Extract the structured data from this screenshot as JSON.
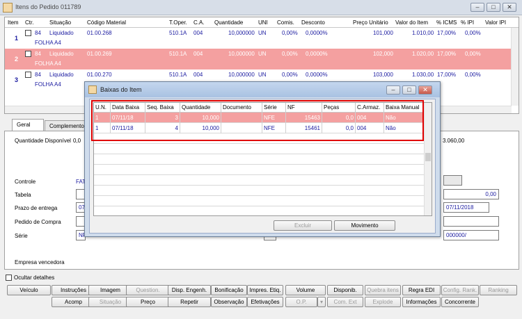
{
  "window": {
    "title": "Itens do Pedido 011789"
  },
  "grid": {
    "headers": [
      "Item",
      "Ctr.",
      "Situação",
      "Código Material",
      "T.Oper.",
      "C.A.",
      "Quantidade",
      "UNI",
      "Comis.",
      "Desconto",
      "Preço Unitário",
      "Valor do Item",
      "% ICMS",
      "% IPI",
      "Valor IPI"
    ],
    "rows": [
      {
        "item": "1",
        "ctr": "84",
        "situacao": "Liquidado",
        "sub": "FOLHA A4",
        "codigo": "01.00.268",
        "toper": "510.1A",
        "ca": "004",
        "quantidade": "10,000000",
        "uni": "UN",
        "comis": "0,00%",
        "desconto": "0,0000%",
        "preco": "101,000",
        "valor": "1.010,00",
        "icms": "17,00%",
        "ipi": "0,00%"
      },
      {
        "item": "2",
        "ctr": "84",
        "situacao": "Liquidado",
        "sub": "FOLHA A4",
        "codigo": "01.00.269",
        "toper": "510.1A",
        "ca": "004",
        "quantidade": "10,000000",
        "uni": "UN",
        "comis": "0,00%",
        "desconto": "0,0000%",
        "preco": "102,000",
        "valor": "1.020,00",
        "icms": "17,00%",
        "ipi": "0,00%"
      },
      {
        "item": "3",
        "ctr": "84",
        "situacao": "Liquidado",
        "sub": "FOLHA A4",
        "codigo": "01.00.270",
        "toper": "510.1A",
        "ca": "004",
        "quantidade": "10,000000",
        "uni": "UN",
        "comis": "0,00%",
        "desconto": "0,0000%",
        "preco": "103,000",
        "valor": "1.030,00",
        "icms": "17,00%",
        "ipi": "0,00%"
      }
    ]
  },
  "tabs": [
    "Geral",
    "Complemento"
  ],
  "form": {
    "qtd_disponivel_label": "Quantidade Disponível",
    "qtd_disponivel_value": "0,0",
    "right_value": "3.060,00",
    "controle_label": "Controle",
    "controle_value": "FAT",
    "tabela_label": "Tabela",
    "tabela_right_value": "0,00",
    "prazo_label": "Prazo de entrega",
    "prazo_value": "07/",
    "prazo_right_value": "07/11/2018",
    "pedido_compra_label": "Pedido de Compra",
    "serie_label": "Série",
    "serie_value": "NF",
    "serie_right_value": "000000/",
    "empresa_label": "Empresa vencedora",
    "ocultar_label": "Ocultar detalhes"
  },
  "buttons_row1": [
    {
      "label": "Veículo",
      "enabled": true
    },
    {
      "label": "Instruções",
      "enabled": true
    },
    {
      "label": "Imagem",
      "enabled": true
    },
    {
      "label": "Question.",
      "enabled": false
    },
    {
      "label": "Disp. Engenh.",
      "enabled": true
    },
    {
      "label": "Bonificação",
      "enabled": true
    },
    {
      "label": "Impres. Etiq.",
      "enabled": true
    },
    {
      "label": "Volume",
      "enabled": true
    },
    {
      "label": "Disponib.",
      "enabled": true
    },
    {
      "label": "Quebra itens",
      "enabled": false
    },
    {
      "label": "Regra EDI",
      "enabled": true
    },
    {
      "label": "Config. Rank.",
      "enabled": false
    },
    {
      "label": "Ranking",
      "enabled": false
    }
  ],
  "buttons_row2": [
    {
      "label": "Acomp",
      "enabled": true
    },
    {
      "label": "Situação",
      "enabled": false
    },
    {
      "label": "Preço",
      "enabled": true
    },
    {
      "label": "Repetir",
      "enabled": true
    },
    {
      "label": "Observação",
      "enabled": true
    },
    {
      "label": "Efetivações",
      "enabled": true
    },
    {
      "label": "O.P.",
      "enabled": false
    },
    {
      "label": "Com. Ext",
      "enabled": false
    },
    {
      "label": "Explode",
      "enabled": false
    },
    {
      "label": "Informações",
      "enabled": true
    },
    {
      "label": "Concorrente",
      "enabled": true
    }
  ],
  "dialog": {
    "title": "Baixas do Item",
    "headers": [
      "U.N.",
      "Data Baixa",
      "Seq. Baixa",
      "Quantidade",
      "Documento",
      "Série",
      "NF",
      "Peças",
      "C.Armaz.",
      "Baixa Manual"
    ],
    "rows": [
      {
        "un": "1",
        "data": "07/11/18",
        "seq": "3",
        "qtd": "10,000",
        "doc": "",
        "serie": "NFE",
        "nf": "15463",
        "pecas": "0,0",
        "armaz": "004",
        "manual": "Não"
      },
      {
        "un": "1",
        "data": "07/11/18",
        "seq": "4",
        "qtd": "10,000",
        "doc": "",
        "serie": "NFE",
        "nf": "15461",
        "pecas": "0,0",
        "armaz": "004",
        "manual": "Não"
      }
    ],
    "excluir_label": "Excluir",
    "movimento_label": "Movimento"
  }
}
